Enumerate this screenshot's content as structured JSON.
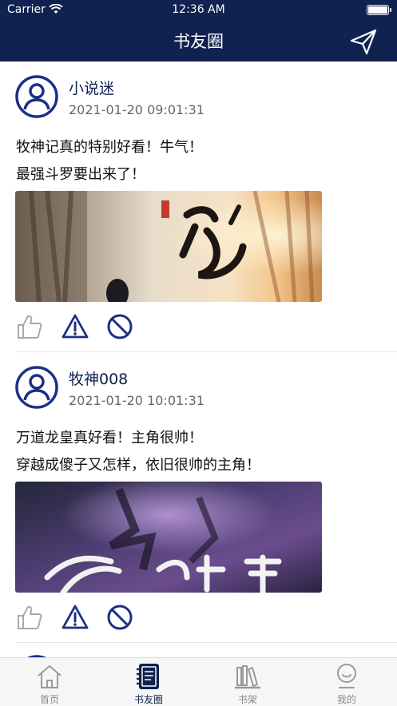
{
  "status_bar": {
    "carrier": "Carrier",
    "time": "12:36 AM"
  },
  "header": {
    "title": "书友圈",
    "send_icon": "send-icon"
  },
  "posts": [
    {
      "username": "小说迷",
      "timestamp": "2021-01-20 09:01:31",
      "lines": [
        "牧神记真的特别好看！牛气！",
        "最强斗罗要出来了！"
      ]
    },
    {
      "username": "牧神008",
      "timestamp": "2021-01-20 10:01:31",
      "lines": [
        "万道龙皇真好看！主角很帅！",
        "穿越成傻子又怎样，依旧很帅的主角！"
      ]
    }
  ],
  "tabs": [
    {
      "label": "首页",
      "icon": "home-icon"
    },
    {
      "label": "书友圈",
      "icon": "notebook-icon",
      "active": true
    },
    {
      "label": "书架",
      "icon": "bookshelf-icon"
    },
    {
      "label": "我的",
      "icon": "profile-icon"
    }
  ],
  "colors": {
    "brand": "#0f2250",
    "accent_icon": "#1b2f87"
  }
}
